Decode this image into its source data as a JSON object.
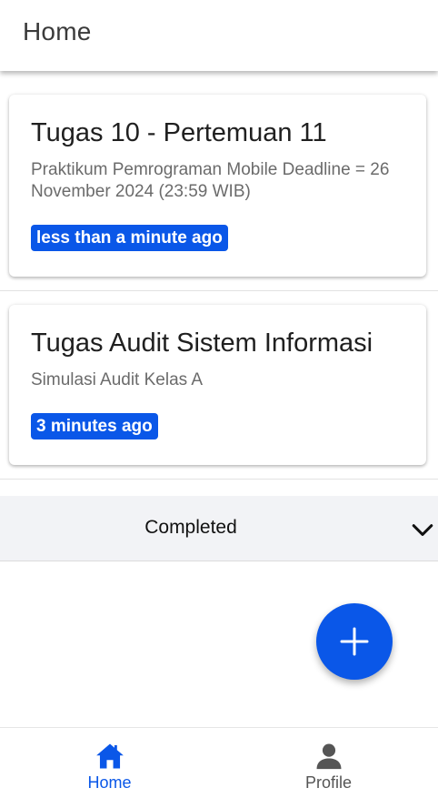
{
  "appbar": {
    "title": "Home"
  },
  "tasks": [
    {
      "title": "Tugas 10 - Pertemuan 11",
      "description": "Praktikum Pemrograman Mobile Deadline = 26 November 2024 (23:59 WIB)",
      "time": "less than a minute ago"
    },
    {
      "title": "Tugas Audit Sistem Informasi",
      "description": "Simulasi Audit Kelas A",
      "time": "3 minutes ago"
    }
  ],
  "completed": {
    "label": "Completed",
    "icon": "chevron-down-icon"
  },
  "fab": {
    "icon": "plus-icon"
  },
  "bottom_nav": {
    "items": [
      {
        "label": "Home",
        "icon": "home-icon",
        "active": true
      },
      {
        "label": "Profile",
        "icon": "person-icon",
        "active": false
      }
    ]
  },
  "colors": {
    "accent": "#0a57e8",
    "inactive": "#555555",
    "section_bg": "#f2f3f6"
  }
}
